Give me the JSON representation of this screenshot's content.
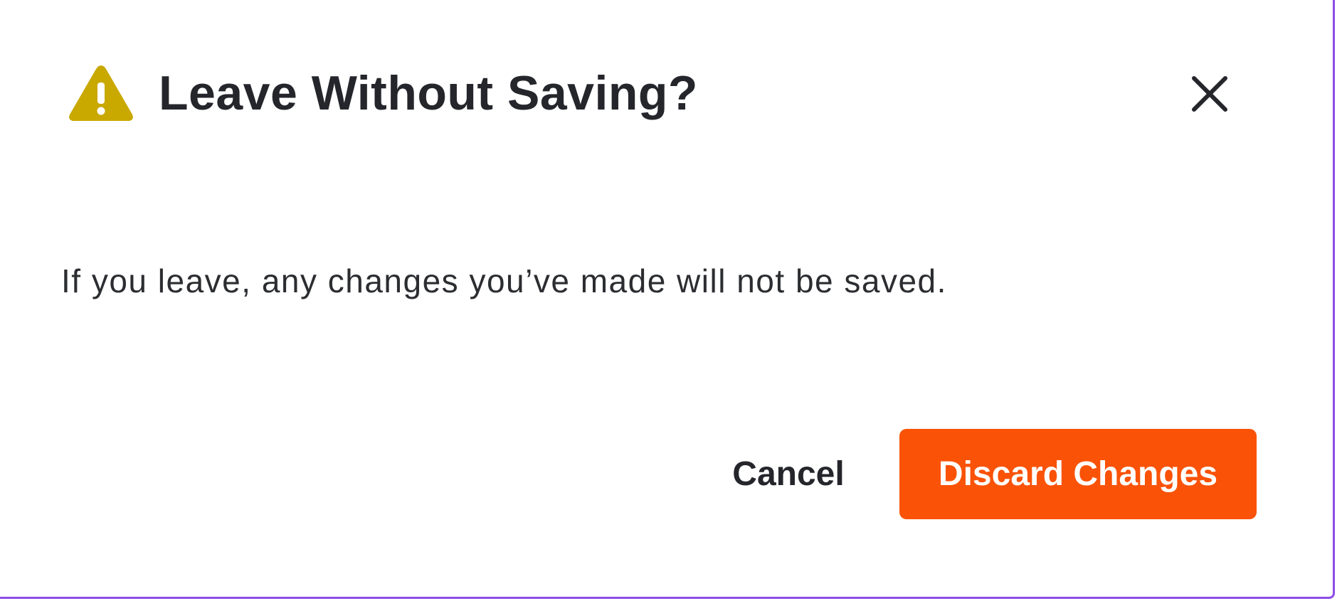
{
  "dialog": {
    "title": "Leave Without Saving?",
    "message": "If you leave, any changes you’ve made will not be saved.",
    "title_icon": "warning-icon",
    "close_icon": "close-icon",
    "buttons": {
      "cancel_label": "Cancel",
      "discard_label": "Discard Changes"
    }
  },
  "colors": {
    "warning": "#c9a800",
    "primary_action": "#fa5206",
    "text": "#24262b",
    "border_accent": "#8a4de6"
  }
}
